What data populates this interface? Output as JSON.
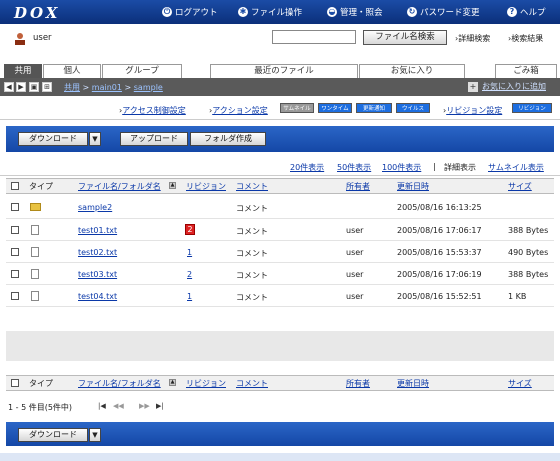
{
  "header": {
    "logo": "DOX",
    "nav": [
      {
        "label": "ログアウト",
        "icon": "power-icon"
      },
      {
        "label": "ファイル操作",
        "icon": "gear-icon"
      },
      {
        "label": "管理・照会",
        "icon": "half-circle-icon"
      },
      {
        "label": "パスワード変更",
        "icon": "refresh-icon"
      },
      {
        "label": "ヘルプ",
        "icon": "help-icon"
      }
    ]
  },
  "user": {
    "name": "user"
  },
  "search": {
    "button_label": "ファイル名検索",
    "placeholder": "",
    "advanced_label": "詳細検索",
    "results_label": "検索結果"
  },
  "tabs": [
    "共用",
    "個人",
    "グループ",
    "最近のファイル",
    "お気に入り",
    "ごみ箱"
  ],
  "path": {
    "root": "共用",
    "folder1": "main01",
    "folder2": "sample",
    "sep": ">",
    "fav_add": "お気に入りに追加"
  },
  "settings": {
    "access": "アクセス制御設定",
    "action": "アクション設定",
    "badges": [
      "サムネイル",
      "ワンタイム",
      "更新通知",
      "ウイルス"
    ],
    "revision": "リビジョン設定",
    "revision_badge": "リビジョン"
  },
  "toolbar": {
    "download": "ダウンロード",
    "upload": "アップロード",
    "create_folder": "フォルダ作成"
  },
  "view": {
    "v20": "20件表示",
    "v50": "50件表示",
    "v100": "100件表示",
    "sep": "|",
    "detail": "詳細表示",
    "thumb": "サムネイル表示"
  },
  "columns": {
    "type": "タイプ",
    "name": "ファイル名/フォルダ名",
    "revision": "リビジョン",
    "comment": "コメント",
    "owner": "所有者",
    "updated": "更新日時",
    "size": "サイズ"
  },
  "rows": [
    {
      "type": "folder",
      "name": "sample2",
      "revision": "",
      "comment": "コメント",
      "owner": "",
      "updated": "2005/08/16 16:13:25",
      "size": ""
    },
    {
      "type": "file",
      "name": "test01.txt",
      "revision": "2",
      "comment": "コメント",
      "owner": "user",
      "updated": "2005/08/16 17:06:17",
      "size": "388 Bytes"
    },
    {
      "type": "file",
      "name": "test02.txt",
      "revision": "1",
      "comment": "コメント",
      "owner": "user",
      "updated": "2005/08/16 15:53:37",
      "size": "490 Bytes"
    },
    {
      "type": "file",
      "name": "test03.txt",
      "revision": "2",
      "comment": "コメント",
      "owner": "user",
      "updated": "2005/08/16 17:06:19",
      "size": "388 Bytes"
    },
    {
      "type": "file",
      "name": "test04.txt",
      "revision": "1",
      "comment": "コメント",
      "owner": "user",
      "updated": "2005/08/16 15:52:51",
      "size": "1 KB"
    }
  ],
  "pager": {
    "info": "1 - 5 件目(5件中)"
  }
}
